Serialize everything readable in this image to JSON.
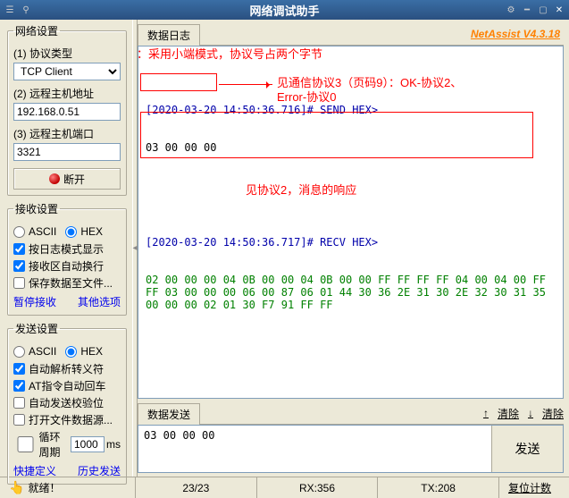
{
  "titlebar": {
    "title": "网络调试助手"
  },
  "brand": "NetAssist V4.3.18",
  "netset": {
    "legend": "网络设置",
    "proto_label": "(1) 协议类型",
    "proto_value": "TCP Client",
    "host_label": "(2) 远程主机地址",
    "host_value": "192.168.0.51",
    "port_label": "(3) 远程主机端口",
    "port_value": "3321",
    "disconnect": "断开"
  },
  "recvset": {
    "legend": "接收设置",
    "ascii": "ASCII",
    "hex": "HEX",
    "opt1": "按日志模式显示",
    "opt2": "接收区自动换行",
    "opt3": "保存数据至文件...",
    "link1": "暂停接收",
    "link2": "其他选项"
  },
  "sendset": {
    "legend": "发送设置",
    "ascii": "ASCII",
    "hex": "HEX",
    "opt1": "自动解析转义符",
    "opt2": "AT指令自动回车",
    "opt3": "自动发送校验位",
    "opt4": "打开文件数据源...",
    "loop_label": "循环周期",
    "loop_value": "1000",
    "loop_unit": "ms",
    "link1": "快捷定义",
    "link2": "历史发送"
  },
  "datalog": {
    "tab": "数据日志",
    "send_meta": "[2020-03-20 14:50:36.716]# SEND HEX>",
    "send_hex": "03 00 00 00",
    "recv_meta": "[2020-03-20 14:50:36.717]# RECV HEX>",
    "recv_hex": "02 00 00 00 04 0B 00 00 04 0B 00 00 FF FF FF FF 04 00 04 00 FF FF 03 00 00 00 06 00 87 06 01 44 30 36 2E 31 30 2E 32 30 31 35 00 00 00 02 01 30 F7 91 FF FF"
  },
  "annotations": {
    "a1": "协议：采用小端模式，协议号占两个字节",
    "a2a": "见通信协议3（页码9）：OK-协议2、",
    "a2b": "Error-协议0",
    "a3": "见协议2，消息的响应"
  },
  "sendarea": {
    "tab": "数据发送",
    "nav_prev": "↑",
    "nav_next": "↓",
    "clear": "清除",
    "text": "03 00 00 00",
    "send_btn": "发送"
  },
  "status": {
    "ready_icon": "👆",
    "ready": "就绪！",
    "c1": "23/23",
    "c2": "RX:356",
    "c3": "TX:208",
    "reset": "复位计数"
  }
}
